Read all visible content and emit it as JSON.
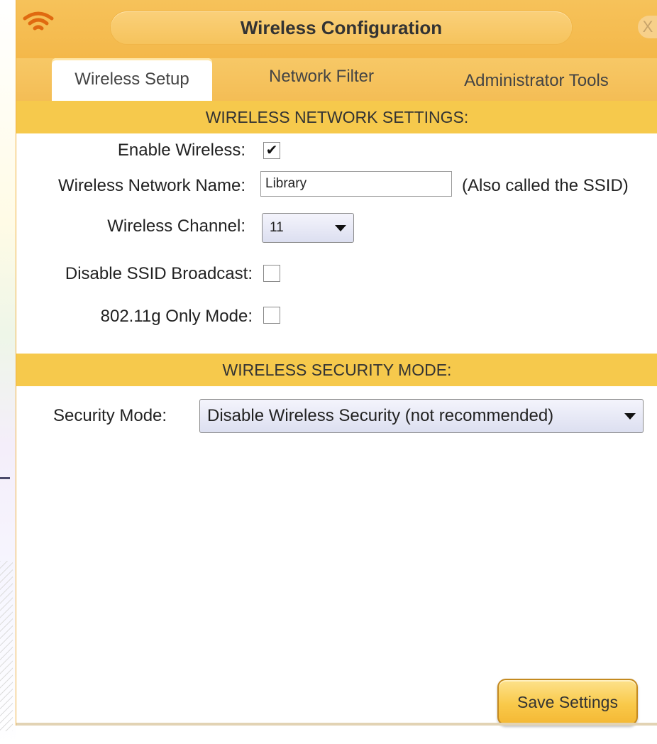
{
  "window": {
    "title": "Wireless Configuration",
    "close_glyph": "X",
    "icon": "wifi-icon"
  },
  "tabs": [
    {
      "label": "Wireless Setup",
      "active": true
    },
    {
      "label": "Network Filter",
      "active": false
    },
    {
      "label": "Administrator Tools",
      "active": false
    }
  ],
  "network_settings": {
    "header": "WIRELESS NETWORK SETTINGS:",
    "enable_wireless_label": "Enable Wireless:",
    "enable_wireless_checked": true,
    "network_name_label": "Wireless Network Name:",
    "network_name_value": "Library",
    "network_name_note": "(Also called the SSID)",
    "channel_label": "Wireless Channel:",
    "channel_value": "11",
    "disable_ssid_label": "Disable SSID Broadcast:",
    "disable_ssid_checked": false,
    "g_only_label": "802.11g Only Mode:",
    "g_only_checked": false
  },
  "security": {
    "header": "WIRELESS SECURITY MODE:",
    "mode_label": "Security Mode:",
    "mode_value": "Disable Wireless Security (not recommended)"
  },
  "actions": {
    "save_label": "Save Settings"
  },
  "colors": {
    "title_bar": "#f4b84a",
    "section_header": "#f6c94c",
    "button": "#f9c94a"
  }
}
